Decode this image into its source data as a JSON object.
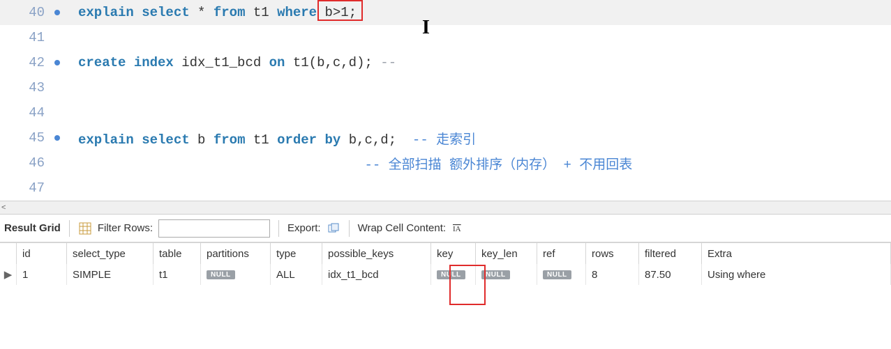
{
  "editor": {
    "lines": [
      {
        "num": "40",
        "has_dot": true,
        "highlighted": true,
        "tokens": [
          {
            "cls": "kw",
            "t": "explain select"
          },
          {
            "cls": "star",
            "t": " * "
          },
          {
            "cls": "kw",
            "t": "from"
          },
          {
            "cls": "ident",
            "t": " t1 "
          },
          {
            "cls": "kw",
            "t": "where"
          },
          {
            "cls": "ident",
            "t": " b>1;"
          }
        ]
      },
      {
        "num": "41",
        "has_dot": false,
        "tokens": []
      },
      {
        "num": "42",
        "has_dot": true,
        "tokens": [
          {
            "cls": "kw",
            "t": "create index"
          },
          {
            "cls": "ident",
            "t": " idx_t1_bcd "
          },
          {
            "cls": "kw",
            "t": "on"
          },
          {
            "cls": "ident",
            "t": " t1(b,c,d); "
          },
          {
            "cls": "cmnt",
            "t": "--"
          }
        ]
      },
      {
        "num": "43",
        "has_dot": false,
        "tokens": []
      },
      {
        "num": "44",
        "has_dot": false,
        "tokens": []
      },
      {
        "num": "45",
        "has_dot": true,
        "tokens": [
          {
            "cls": "kw",
            "t": "explain select"
          },
          {
            "cls": "ident",
            "t": " b "
          },
          {
            "cls": "kw",
            "t": "from"
          },
          {
            "cls": "ident",
            "t": " t1 "
          },
          {
            "cls": "kw",
            "t": "order by"
          },
          {
            "cls": "ident",
            "t": " b,c,d;  "
          },
          {
            "cls": "cmnt-cn",
            "t": "-- 走索引"
          }
        ]
      },
      {
        "num": "46",
        "has_dot": false,
        "tokens": [
          {
            "cls": "ident",
            "t": "                                    "
          },
          {
            "cls": "cmnt-cn",
            "t": "-- 全部扫描 额外排序（内存） + 不用回表"
          }
        ]
      },
      {
        "num": "47",
        "has_dot": false,
        "tokens": []
      }
    ]
  },
  "toolbar": {
    "result_grid_label": "Result Grid",
    "filter_rows_label": "Filter Rows:",
    "filter_value": "",
    "export_label": "Export:",
    "wrap_label": "Wrap Cell Content:"
  },
  "grid": {
    "headers": {
      "id": "id",
      "select_type": "select_type",
      "table": "table",
      "partitions": "partitions",
      "type": "type",
      "possible_keys": "possible_keys",
      "key": "key",
      "key_len": "key_len",
      "ref": "ref",
      "rows": "rows",
      "filtered": "filtered",
      "extra": "Extra"
    },
    "null_text": "NULL",
    "rows": [
      {
        "handle": "▶",
        "id": "1",
        "select_type": "SIMPLE",
        "table": "t1",
        "partitions": null,
        "type": "ALL",
        "possible_keys": "idx_t1_bcd",
        "key": null,
        "key_len": null,
        "ref": null,
        "rows": "8",
        "filtered": "87.50",
        "extra": "Using where"
      }
    ]
  },
  "scroll_left_glyph": "<"
}
